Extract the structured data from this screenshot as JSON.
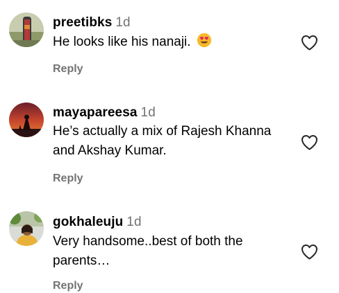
{
  "comments": [
    {
      "username": "preetibks",
      "age": "1d",
      "text": "He looks like his nanaji.",
      "emoji": "heart-eyes-emoji",
      "reply_label": "Reply"
    },
    {
      "username": "mayapareesa",
      "age": "1d",
      "text": "He’s actually a mix of Rajesh Khanna and Akshay Kumar.",
      "reply_label": "Reply"
    },
    {
      "username": "gokhaleuju",
      "age": "1d",
      "text": "Very handsome..best of both the parents…",
      "reply_label": "Reply"
    }
  ],
  "icons": {
    "like": "heart-outline-icon",
    "emoji": "smiling-face-with-heart-eyes"
  },
  "colors": {
    "secondary_text": "#737373",
    "primary_text": "#000000",
    "background": "#ffffff"
  }
}
